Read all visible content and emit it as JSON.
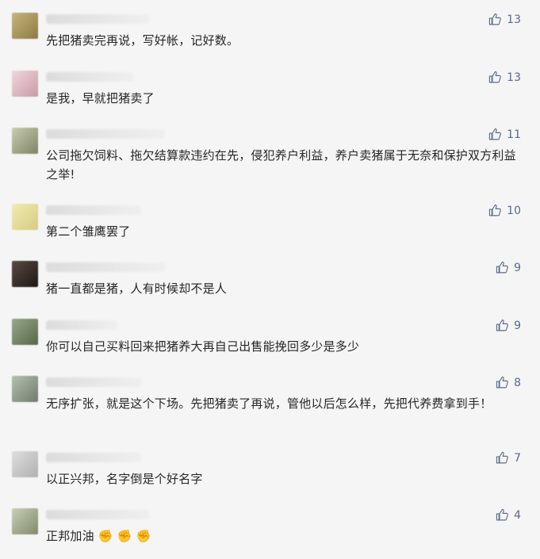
{
  "comments": [
    {
      "text": "先把猪卖完再说，写好帐，记好数。",
      "likes": "13",
      "avatar_color": "#b7a46a"
    },
    {
      "text": "是我，早就把猪卖了",
      "likes": "13",
      "avatar_color": "#d8b8c0"
    },
    {
      "text": "公司拖欠饲料、拖欠结算款违约在先，侵犯养户利益，养户卖猪属于无奈和保护双方利益之举!",
      "likes": "11",
      "avatar_color": "#a8ad8e"
    },
    {
      "text": "第二个雏鹰罢了",
      "likes": "10",
      "avatar_color": "#e6df9c"
    },
    {
      "text": "猪一直都是猪，人有时候却不是人",
      "likes": "9",
      "avatar_color": "#3a2e2a"
    },
    {
      "text": "你可以自己买料回来把猪养大再自己出售能挽回多少是多少",
      "likes": "9",
      "avatar_color": "#7a8f6e"
    },
    {
      "text": "无序扩张，就是这个下场。先把猪卖了再说，管他以后怎么样，先把代养费拿到手！",
      "likes": "8",
      "avatar_color": "#8e9a8a"
    },
    {
      "text": "以正兴邦，名字倒是个好名字",
      "likes": "7",
      "avatar_color": "#c6c6c6"
    },
    {
      "text": "正邦加油",
      "emoji": "✊ ✊ ✊",
      "likes": "4",
      "avatar_color": "#aeb59d"
    }
  ]
}
